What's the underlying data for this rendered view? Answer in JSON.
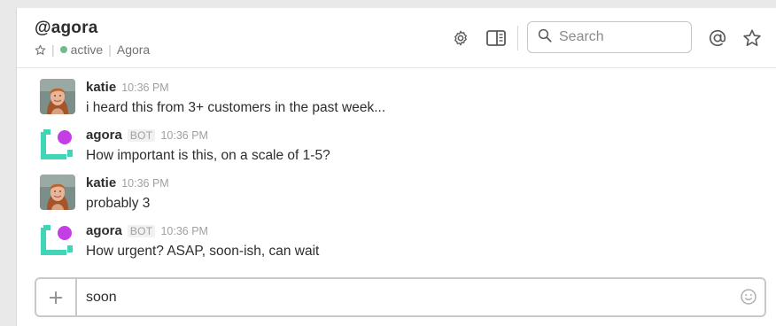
{
  "header": {
    "channel_name": "@agora",
    "status": "active",
    "workspace": "Agora",
    "search_placeholder": "Search",
    "icons": [
      "gear-icon",
      "sidebar-toggle-icon",
      "search-icon",
      "mention-icon",
      "star-icon"
    ]
  },
  "messages": [
    {
      "sender": "katie",
      "time": "10:36 PM",
      "text": "i heard this from 3+ customers in the past week...",
      "avatar": "katie-avatar"
    },
    {
      "sender": "agora",
      "badge": "BOT",
      "time": "10:36 PM",
      "text": "How important is this, on a scale of 1-5?",
      "avatar": "agora-bot-avatar"
    },
    {
      "sender": "katie",
      "time": "10:36 PM",
      "text": "probably 3",
      "avatar": "katie-avatar"
    },
    {
      "sender": "agora",
      "badge": "BOT",
      "time": "10:36 PM",
      "text": "How urgent? ASAP, soon-ish, can wait",
      "avatar": "agora-bot-avatar"
    }
  ],
  "composer": {
    "value": "soon",
    "icons": [
      "plus-icon",
      "emoji-icon"
    ]
  },
  "colors": {
    "presence": "#6fbb8d",
    "bot_logo_teal": "#3fd6b8",
    "bot_logo_purple": "#c43ee6",
    "text": "#2c2d30",
    "muted": "#a0a0a2"
  }
}
